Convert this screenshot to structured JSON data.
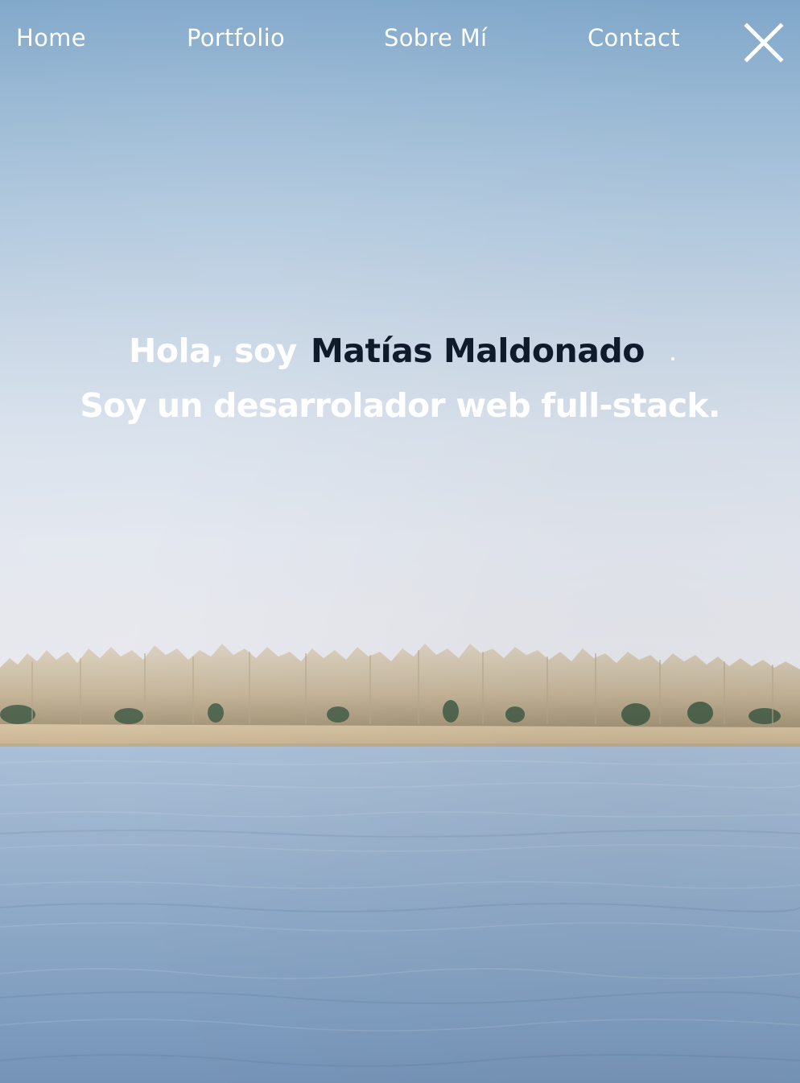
{
  "nav": {
    "items": [
      {
        "label": "Home"
      },
      {
        "label": "Portfolio"
      },
      {
        "label": "Sobre Mí"
      },
      {
        "label": "Contact"
      }
    ],
    "close_icon": "close-x-icon"
  },
  "hero": {
    "greeting": "Hola, soy",
    "name": "Matías Maldonado",
    "tagline": "Soy un desarrolador web full-stack."
  },
  "colors": {
    "nav_text": "#ffffff",
    "hero_text": "#ffffff",
    "name_text": "#0f1a2a",
    "sky_top": "#7fa6c9",
    "sky_bottom": "#e9e9ee",
    "water": "#8ea9c7"
  }
}
